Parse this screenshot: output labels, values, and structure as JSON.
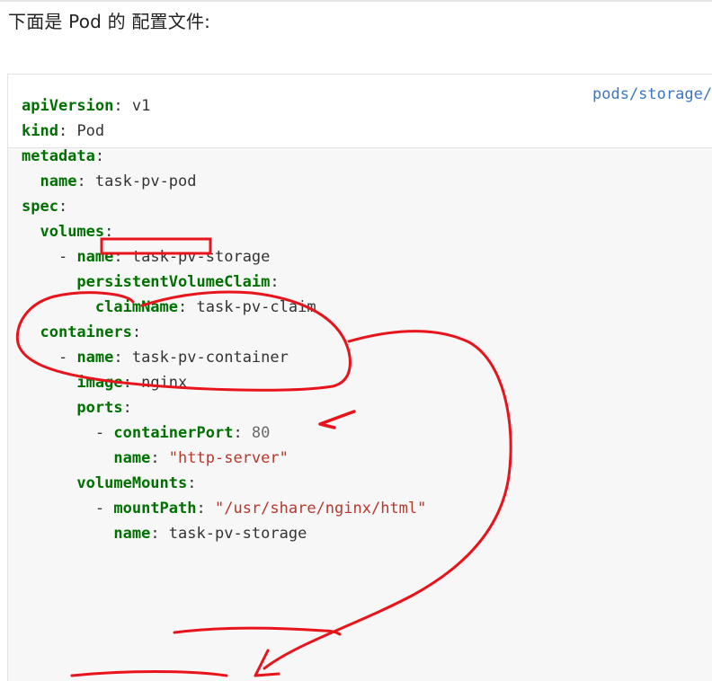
{
  "intro_text": "下面是 Pod 的 配置文件:",
  "file_link": "pods/storage/",
  "code_lines": [
    {
      "indent": "",
      "dash": "",
      "key": "apiVersion",
      "sep": ": ",
      "value": "v1",
      "vtype": "plain"
    },
    {
      "indent": "",
      "dash": "",
      "key": "kind",
      "sep": ": ",
      "value": "Pod",
      "vtype": "plain"
    },
    {
      "indent": "",
      "dash": "",
      "key": "metadata",
      "sep": ":",
      "value": "",
      "vtype": "plain"
    },
    {
      "indent": "  ",
      "dash": "",
      "key": "name",
      "sep": ": ",
      "value": "task-pv-pod",
      "vtype": "plain"
    },
    {
      "indent": "",
      "dash": "",
      "key": "spec",
      "sep": ":",
      "value": "",
      "vtype": "plain"
    },
    {
      "indent": "  ",
      "dash": "",
      "key": "volumes",
      "sep": ":",
      "value": "",
      "vtype": "plain"
    },
    {
      "indent": "    ",
      "dash": "- ",
      "key": "name",
      "sep": ": ",
      "value": "task-pv-storage",
      "vtype": "plain"
    },
    {
      "indent": "      ",
      "dash": "",
      "key": "persistentVolumeClaim",
      "sep": ":",
      "value": "",
      "vtype": "plain"
    },
    {
      "indent": "        ",
      "dash": "",
      "key": "claimName",
      "sep": ": ",
      "value": "task-pv-claim",
      "vtype": "plain"
    },
    {
      "indent": "  ",
      "dash": "",
      "key": "containers",
      "sep": ":",
      "value": "",
      "vtype": "plain"
    },
    {
      "indent": "    ",
      "dash": "- ",
      "key": "name",
      "sep": ": ",
      "value": "task-pv-container",
      "vtype": "plain"
    },
    {
      "indent": "      ",
      "dash": "",
      "key": "image",
      "sep": ": ",
      "value": "nginx",
      "vtype": "plain"
    },
    {
      "indent": "      ",
      "dash": "",
      "key": "ports",
      "sep": ":",
      "value": "",
      "vtype": "plain"
    },
    {
      "indent": "        ",
      "dash": "- ",
      "key": "containerPort",
      "sep": ": ",
      "value": "80",
      "vtype": "number"
    },
    {
      "indent": "          ",
      "dash": "",
      "key": "name",
      "sep": ": ",
      "value": "\"http-server\"",
      "vtype": "string"
    },
    {
      "indent": "      ",
      "dash": "",
      "key": "volumeMounts",
      "sep": ":",
      "value": "",
      "vtype": "plain"
    },
    {
      "indent": "        ",
      "dash": "- ",
      "key": "mountPath",
      "sep": ": ",
      "value": "\"/usr/share/nginx/html\"",
      "vtype": "string"
    },
    {
      "indent": "          ",
      "dash": "",
      "key": "name",
      "sep": ": ",
      "value": "task-pv-storage",
      "vtype": "plain"
    }
  ],
  "colors": {
    "yaml_key": "#007000",
    "yaml_string": "#b5382c",
    "yaml_number": "#6b6b6b",
    "link": "#3a76c4",
    "annotation_red": "#e8141c"
  }
}
